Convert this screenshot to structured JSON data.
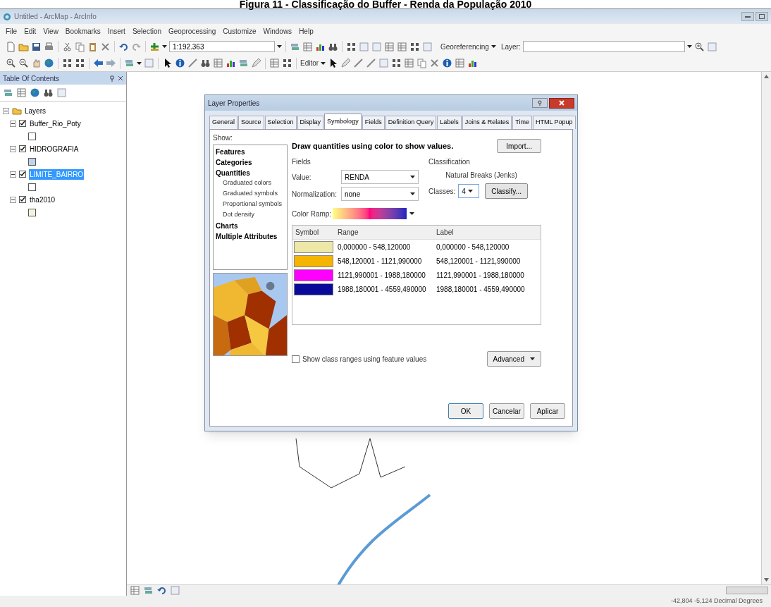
{
  "caption": "Figura 11 - Classificação do Buffer - Renda da População 2010",
  "window": {
    "title": "Untitled - ArcMap - ArcInfo"
  },
  "menu": [
    "File",
    "Edit",
    "View",
    "Bookmarks",
    "Insert",
    "Selection",
    "Geoprocessing",
    "Customize",
    "Windows",
    "Help"
  ],
  "toolbar": {
    "scale": "1:192.363",
    "georeferencing": "Georeferencing",
    "layer_label": "Layer:",
    "editor": "Editor"
  },
  "toc": {
    "title": "Table Of Contents",
    "root": {
      "label": "Layers",
      "expanded": true,
      "children": [
        {
          "label": "Buffer_Rio_Poty",
          "checked": true,
          "selected": false,
          "expanded": true,
          "color": "#ffffff"
        },
        {
          "label": "HIDROGRAFIA",
          "checked": true,
          "selected": false,
          "expanded": true,
          "color": "#bcd4ee"
        },
        {
          "label": "LIMITE_BAIRRO",
          "checked": true,
          "selected": true,
          "expanded": true,
          "color": "#ffffff"
        },
        {
          "label": "tha2010",
          "checked": true,
          "selected": false,
          "expanded": true,
          "color": "#f6f3dc"
        }
      ]
    }
  },
  "dialog": {
    "title": "Layer Properties",
    "tabs": [
      {
        "label": "General",
        "selected": false
      },
      {
        "label": "Source",
        "selected": false
      },
      {
        "label": "Selection",
        "selected": false
      },
      {
        "label": "Display",
        "selected": false
      },
      {
        "label": "Symbology",
        "selected": true
      },
      {
        "label": "Fields",
        "selected": false
      },
      {
        "label": "Definition Query",
        "selected": false
      },
      {
        "label": "Labels",
        "selected": false
      },
      {
        "label": "Joins & Relates",
        "selected": false
      },
      {
        "label": "Time",
        "selected": false
      },
      {
        "label": "HTML Popup",
        "selected": false
      }
    ],
    "show_label": "Show:",
    "show_items": [
      {
        "label": "Features"
      },
      {
        "label": "Categories"
      },
      {
        "label": "Quantities",
        "children": [
          {
            "label": "Graduated colors"
          },
          {
            "label": "Graduated symbols"
          },
          {
            "label": "Proportional symbols"
          },
          {
            "label": "Dot density"
          }
        ]
      },
      {
        "label": "Charts"
      },
      {
        "label": "Multiple Attributes"
      }
    ],
    "heading": "Draw quantities using color to show values.",
    "import_button": "Import...",
    "fields": {
      "title": "Fields",
      "value_label": "Value:",
      "value": "RENDA",
      "normalization_label": "Normalization:",
      "normalization": "none"
    },
    "classification": {
      "title": "Classification",
      "method": "Natural Breaks (Jenks)",
      "classes_label": "Classes:",
      "classes": "4",
      "classify_button": "Classify..."
    },
    "color_ramp_label": "Color Ramp:",
    "table": {
      "columns": [
        "Symbol",
        "Range",
        "Label"
      ],
      "rows": [
        {
          "color": "#ede8a8",
          "range": "0,000000 - 548,120000",
          "label": "0,000000 - 548,120000"
        },
        {
          "color": "#f5b400",
          "range": "548,120001 - 1121,990000",
          "label": "548,120001 - 1121,990000"
        },
        {
          "color": "#ff00ff",
          "range": "1121,990001 - 1988,180000",
          "label": "1121,990001 - 1988,180000"
        },
        {
          "color": "#0a0a9a",
          "range": "1988,180001 - 4559,490000",
          "label": "1988,180001 - 4559,490000"
        }
      ]
    },
    "show_ranges": {
      "label": "Show class ranges using feature values",
      "checked": false
    },
    "advanced_button": "Advanced",
    "buttons": [
      "OK",
      "Cancelar",
      "Aplicar"
    ]
  },
  "status_bar": {
    "coordinates": "-42,804  -5,124 Decimal Degrees"
  }
}
